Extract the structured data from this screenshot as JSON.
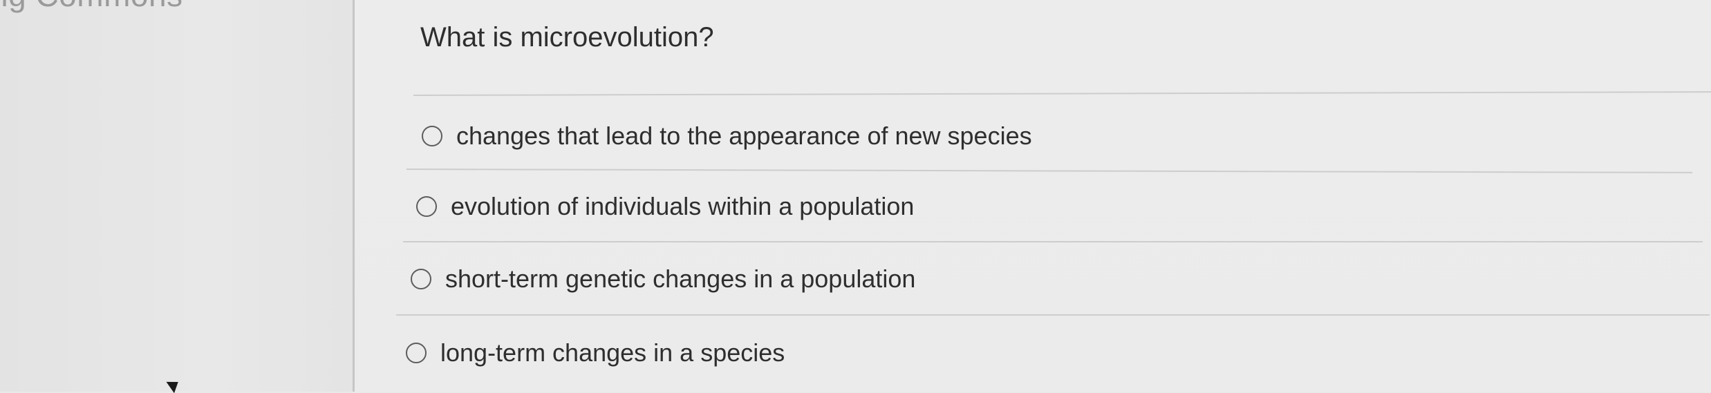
{
  "left_panel": {
    "faded_text": "ng Commons"
  },
  "question": {
    "text": "What is microevolution?"
  },
  "options": [
    {
      "label": "changes that lead to the appearance of new species",
      "selected": false
    },
    {
      "label": "evolution of individuals within a population",
      "selected": false
    },
    {
      "label": "short-term genetic changes in a population",
      "selected": false
    },
    {
      "label": "long-term changes in a species",
      "selected": false
    }
  ]
}
